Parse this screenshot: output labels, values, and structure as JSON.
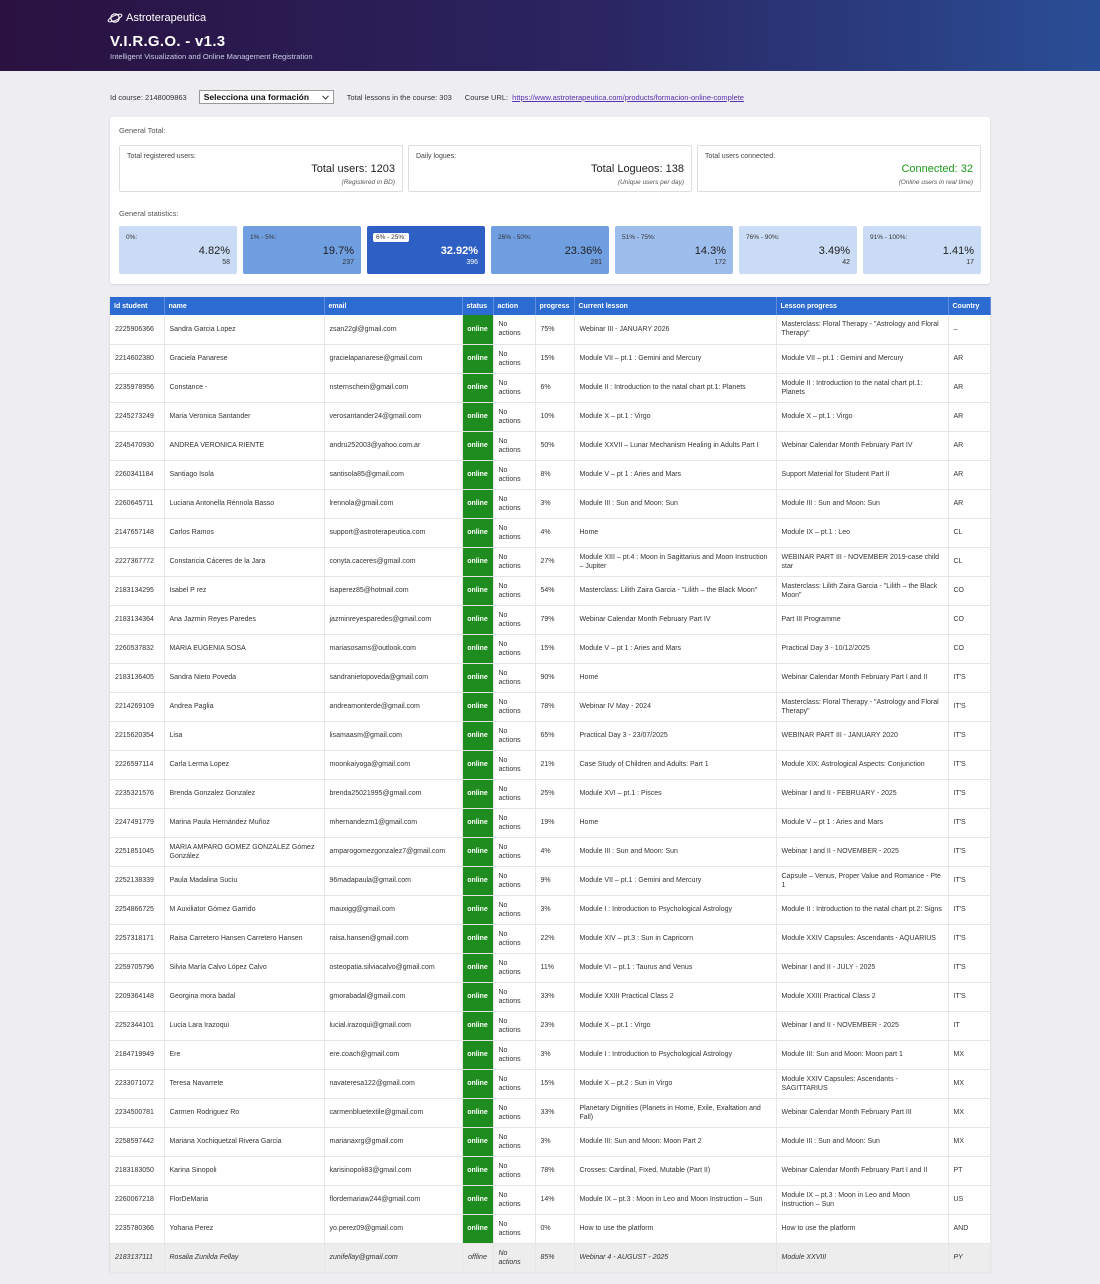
{
  "brand": "Astroterapeutica",
  "title": "V.I.R.G.O. - v1.3",
  "subtitle": "Intelligent Visualization and Online Management Registration",
  "topbar": {
    "id_course_label": "Id course: 2148009863",
    "select_value": "Selecciona una formación",
    "total_lessons": "Total lessons in the course: 303",
    "course_url_label": "Course URL:",
    "course_url": "https://www.astroterapeutica.com/products/formacion-online-complete"
  },
  "general_total_label": "General Total:",
  "totals": [
    {
      "label": "Total registered users:",
      "value": "Total users: 1203",
      "sub": "(Registered in BD)"
    },
    {
      "label": "Daily logues:",
      "value": "Total Logueos: 138",
      "sub": "(Unique users per day)"
    },
    {
      "label": "Total users connected:",
      "value": "Connected: 32",
      "sub": "(Online users in real time)"
    }
  ],
  "general_stats_label": "General statistics:",
  "stats": [
    {
      "label": "0%:",
      "value": "4.82%",
      "count": "58",
      "color": "#c9dbf5"
    },
    {
      "label": "1% - 5%:",
      "value": "19.7%",
      "count": "237",
      "color": "#6f9ee1"
    },
    {
      "label": "6% - 25%:",
      "value": "32.92%",
      "count": "396",
      "color": "#2d5fc4"
    },
    {
      "label": "26% - 50%:",
      "value": "23.36%",
      "count": "281",
      "color": "#6f9ee1"
    },
    {
      "label": "51% - 75%:",
      "value": "14.3%",
      "count": "172",
      "color": "#9dbdec"
    },
    {
      "label": "76% - 90%:",
      "value": "3.49%",
      "count": "42",
      "color": "#c9dbf5"
    },
    {
      "label": "91% - 100%:",
      "value": "1.41%",
      "count": "17",
      "color": "#c9dbf5"
    }
  ],
  "columns": [
    "Id student",
    "name",
    "email",
    "status",
    "action",
    "progress",
    "Current lesson",
    "Lesson progress",
    "Country"
  ],
  "rows": [
    [
      "2225906366",
      "Sandra Garcia Lopez",
      "zsan22gl@gmail.com",
      "online",
      "No actions",
      "75%",
      "Webinar III - JANUARY 2026",
      "Masterclass: Floral Therapy - \"Astrology and Floral Therapy\"",
      "–"
    ],
    [
      "2214602380",
      "Graciela Panarese",
      "gracielapanarese@gmail.com",
      "online",
      "No actions",
      "15%",
      "Module VII – pt.1 : Gemini and Mercury",
      "Module VII – pt.1 : Gemini and Mercury",
      "AR"
    ],
    [
      "2235978956",
      "Constance -",
      "nsternschein@gmail.com",
      "online",
      "No actions",
      "6%",
      "Module II : Introduction to the natal chart pt.1: Planets",
      "Module II : Introduction to the natal chart pt.1: Planets",
      "AR"
    ],
    [
      "2245273249",
      "Maria Veronica Santander",
      "verosantander24@gmail.com",
      "online",
      "No actions",
      "10%",
      "Module X – pt.1 : Virgo",
      "Module X – pt.1 : Virgo",
      "AR"
    ],
    [
      "2245470930",
      "ANDREA VERONICA RIENTE",
      "andru252003@yahoo.com.ar",
      "online",
      "No actions",
      "50%",
      "Module XXVII – Lunar Mechanism Healing in Adults Part I",
      "Webinar Calendar Month February Part IV",
      "AR"
    ],
    [
      "2260341184",
      "Santiago Isola",
      "santisola85@gmail.com",
      "online",
      "No actions",
      "8%",
      "Module V – pt 1 : Aries and Mars",
      "Support Material for Student Part II",
      "AR"
    ],
    [
      "2260645711",
      "Luciana Antonella Rénnola Basso",
      "lrennola@gmail.com",
      "online",
      "No actions",
      "3%",
      "Module III : Sun and Moon: Sun",
      "Module III : Sun and Moon: Sun",
      "AR"
    ],
    [
      "2147657148",
      "Carlos Ramos",
      "support@astroterapeutica.com",
      "online",
      "No actions",
      "4%",
      "Home",
      "Module IX – pt.1 : Leo",
      "CL"
    ],
    [
      "2227367772",
      "Constancia Cáceres de la Jara",
      "conyta.caceres@gmail.com",
      "online",
      "No actions",
      "27%",
      "Module XIII – pt.4 : Moon in Sagittarius and Moon Instruction – Jupiter",
      "WEBINAR PART III - NOVEMBER 2019-case child star",
      "CL"
    ],
    [
      "2183134295",
      "Isabel P rez",
      "isaperez85@hotmail.com",
      "online",
      "No actions",
      "54%",
      "Masterclass: Lilith Zaira Garcia - \"Lilith – the Black Moon\"",
      "Masterclass: Lilith Zaira Garcia - \"Lilith – the Black Moon\"",
      "CO"
    ],
    [
      "2183134364",
      "Ana Jazmin Reyes Paredes",
      "jazminreyesparedes@gmail.com",
      "online",
      "No actions",
      "79%",
      "Webinar Calendar Month February Part IV",
      "Part III Programme",
      "CO"
    ],
    [
      "2260537832",
      "MARIA EUGENIA SOSA",
      "mariasosams@outlook.com",
      "online",
      "No actions",
      "15%",
      "Module V – pt 1 : Aries and Mars",
      "Practical Day 3 - 10/12/2025",
      "CO"
    ],
    [
      "2183136405",
      "Sandra Nieto Poveda",
      "sandranietopoveda@gmail.com",
      "online",
      "No actions",
      "90%",
      "Home",
      "Webinar Calendar Month February Part I and II",
      "IT'S"
    ],
    [
      "2214269109",
      "Andrea Paglia",
      "andreamonterde@gmail.com",
      "online",
      "No actions",
      "78%",
      "Webinar IV May - 2024",
      "Masterclass: Floral Therapy - \"Astrology and Floral Therapy\"",
      "IT'S"
    ],
    [
      "2215620354",
      "Lisa",
      "lisamaasm@gmail.com",
      "online",
      "No actions",
      "65%",
      "Practical Day 3 - 23/07/2025",
      "WEBINAR PART III - JANUARY 2020",
      "IT'S"
    ],
    [
      "2226597114",
      "Carla Lerma Lopez",
      "moonkaiyoga@gmail.com",
      "online",
      "No actions",
      "21%",
      "Case Study of Children and Adults: Part 1",
      "Module XIX: Astrological Aspects: Conjunction",
      "IT'S"
    ],
    [
      "2235321576",
      "Brenda Gonzalez Gonzalez",
      "brenda25021995@gmail.com",
      "online",
      "No actions",
      "25%",
      "Module XVI – pt.1 : Pisces",
      "Webinar I and II - FEBRUARY - 2025",
      "IT'S"
    ],
    [
      "2247491779",
      "Marina Paula Hernández Muñoz",
      "mhernandezm1@gmail.com",
      "online",
      "No actions",
      "19%",
      "Home",
      "Module V – pt 1 : Aries and Mars",
      "IT'S"
    ],
    [
      "2251851045",
      "MARIA AMPARO GOMEZ GONZALEZ Gómez González",
      "amparogomezgonzalez7@gmail.com",
      "online",
      "No actions",
      "4%",
      "Module III : Sun and Moon: Sun",
      "Webinar I and II - NOVEMBER - 2025",
      "IT'S"
    ],
    [
      "2252138339",
      "Paula Madalina Suciu",
      "96madapaula@gmail.com",
      "online",
      "No actions",
      "9%",
      "Module VII – pt.1 : Gemini and Mercury",
      "Capsule – Venus, Proper Value and Romance - Pte 1",
      "IT'S"
    ],
    [
      "2254866725",
      "M Auxiliator Gómez Garrido",
      "mauxigg@gmail.com",
      "online",
      "No actions",
      "3%",
      "Module I : Introduction to Psychological Astrology",
      "Module II : Introduction to the natal chart pt.2: Signs",
      "IT'S"
    ],
    [
      "2257318171",
      "Raisa Carretero Hansen Carretero Hansen",
      "raisa.hansen@gmail.com",
      "online",
      "No actions",
      "22%",
      "Module XIV – pt.3 : Sun in Capricorn",
      "Module XXIV Capsules: Ascendants - AQUARIUS",
      "IT'S"
    ],
    [
      "2259705796",
      "Silvia María Calvo López Calvo",
      "osteopatia.silviacalvo@gmail.com",
      "online",
      "No actions",
      "11%",
      "Module VI – pt.1 : Taurus and Venus",
      "Webinar I and II - JULY - 2025",
      "IT'S"
    ],
    [
      "2209364148",
      "Georgina mora badal",
      "gmorabadal@gmail.com",
      "online",
      "No actions",
      "33%",
      "Module XXIII Practical Class 2",
      "Module XXIII Practical Class 2",
      "IT'S"
    ],
    [
      "2252344101",
      "Lucia Lara Irazoqui",
      "lucial.irazoqui@gmail.com",
      "online",
      "No actions",
      "23%",
      "Module X – pt.1 : Virgo",
      "Webinar I and II - NOVEMBER - 2025",
      "IT"
    ],
    [
      "2184719949",
      "Ere",
      "ere.coach@gmail.com",
      "online",
      "No actions",
      "3%",
      "Module I : Introduction to Psychological Astrology",
      "Module III: Sun and Moon: Moon part 1",
      "MX"
    ],
    [
      "2233071072",
      "Teresa Navarrete",
      "navateresa122@gmail.com",
      "online",
      "No actions",
      "15%",
      "Module X – pt.2 : Sun in Virgo",
      "Module XXIV Capsules: Ascendants - SAGITTARIUS",
      "MX"
    ],
    [
      "2234500781",
      "Carmen Rodriguez Ro",
      "carmenbluetextile@gmail.com",
      "online",
      "No actions",
      "33%",
      "Planetary Dignities (Planets in Home, Exile, Exaltation and Fall)",
      "Webinar Calendar Month February Part III",
      "MX"
    ],
    [
      "2258597442",
      "Mariana Xochiquetzal Rivera Garcia",
      "marianaxrg@gmail.com",
      "online",
      "No actions",
      "3%",
      "Module III: Sun and Moon: Moon Part 2",
      "Module III : Sun and Moon: Sun",
      "MX"
    ],
    [
      "2183183050",
      "Karina Sinopoli",
      "karisinopoli83@gmail.com",
      "online",
      "No actions",
      "78%",
      "Crosses: Cardinal, Fixed, Mutable (Part II)",
      "Webinar Calendar Month February Part I and II",
      "PT"
    ],
    [
      "2260067218",
      "FlorDeMaria",
      "flordemariaw244@gmail.com",
      "online",
      "No actions",
      "14%",
      "Module IX – pt.3 : Moon in Leo and Moon Instruction – Sun",
      "Module IX – pt.3 : Moon in Leo and Moon Instruction – Sun",
      "US"
    ],
    [
      "2235780366",
      "Yohana Perez",
      "yo.perez09@gmail.com",
      "online",
      "No actions",
      "0%",
      "How to use the platform",
      "How to use the platform",
      "AND"
    ],
    [
      "2183137111",
      "Rosalia Zunilda Fellay",
      "zunifellay@gmail.com",
      "offline",
      "No actions",
      "85%",
      "Webinar 4 - AUGUST - 2025",
      "Module XXVIII",
      "PY"
    ]
  ]
}
